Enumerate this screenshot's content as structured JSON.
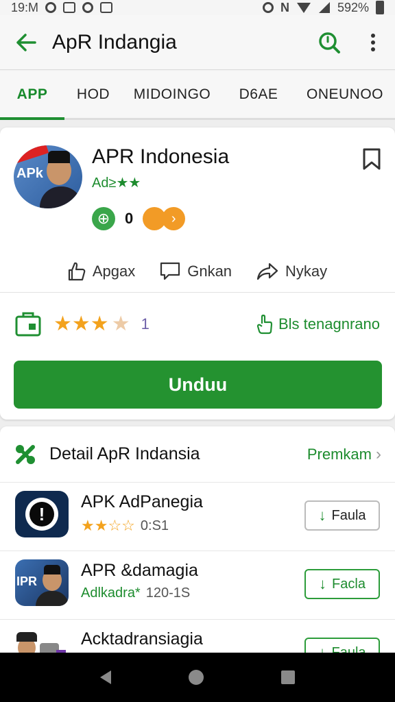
{
  "status_bar": {
    "time": "19:M",
    "battery": "592%"
  },
  "app_bar": {
    "title": "ApR Indangia",
    "back_icon": "arrow-left-icon",
    "search_icon": "search-icon",
    "menu_icon": "more-vertical-icon"
  },
  "tabs": [
    {
      "label": "APP",
      "active": true
    },
    {
      "label": "HOD",
      "active": false
    },
    {
      "label": "MIDOINGO",
      "active": false
    },
    {
      "label": "D6AE",
      "active": false
    },
    {
      "label": "ONEUNOO",
      "active": false
    }
  ],
  "app": {
    "name": "APR Indonesia",
    "subtitle": "Ad≥★★",
    "avatar_text": "APk",
    "badge_count": "0",
    "actions": [
      {
        "label": "Apgax",
        "icon": "thumbs-up-icon"
      },
      {
        "label": "Gnkan",
        "icon": "comment-icon"
      },
      {
        "label": "Nykay",
        "icon": "share-icon"
      }
    ],
    "rating": 3.5,
    "rating_stars": "★★★",
    "rating_half": "★",
    "rating_count": "1",
    "install_note": "Bls tenagnrano",
    "download_label": "Unduu"
  },
  "section": {
    "title": "Detail ApR Indansia",
    "more_label": "Premkam",
    "items": [
      {
        "title": "APK AdPanegia",
        "stars": "★★☆☆",
        "meta": "0:S1",
        "button_label": "Faula"
      },
      {
        "title": "APR &damagia",
        "thumb_text": "IPR",
        "meta_green": "Adlkadra*",
        "meta": "120-1S",
        "button_label": "Facla"
      },
      {
        "title": "Acktadransiagia",
        "button_label": "Faula"
      }
    ]
  },
  "colors": {
    "accent_green": "#249230",
    "star_orange": "#f3a21d",
    "badge_orange": "#f29b26"
  }
}
